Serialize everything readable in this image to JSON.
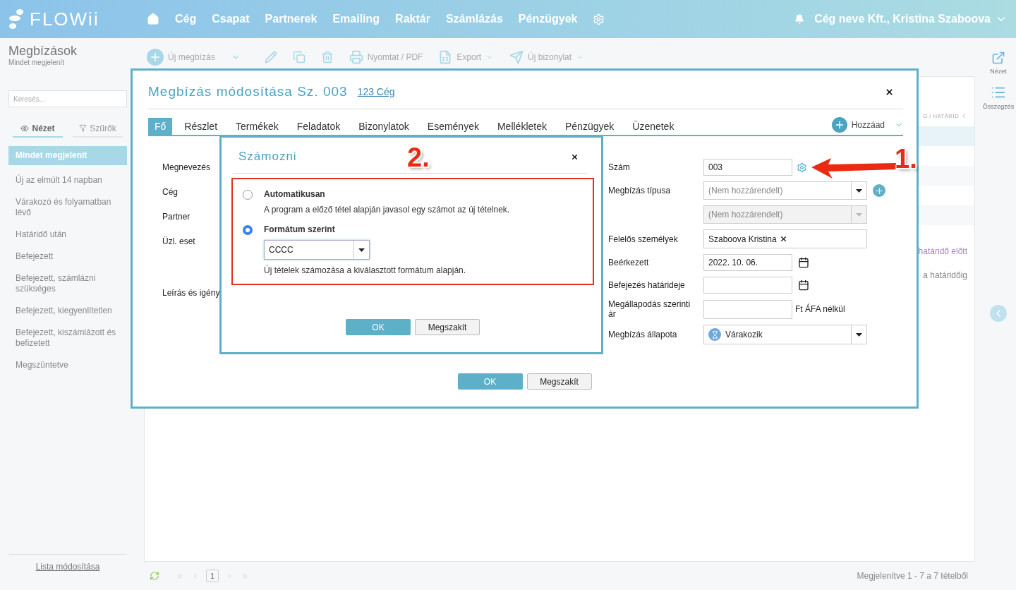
{
  "nav": {
    "logo": "FLOWii",
    "items": [
      "Cég",
      "Csapat",
      "Partnerek",
      "Emailing",
      "Raktár",
      "Számlázás",
      "Pénzügyek"
    ],
    "user": "Cég neve Kft., Kristina Szaboova"
  },
  "sidebar": {
    "title": "Megbízások",
    "subtitle": "Mindet megjelenít",
    "search_placeholder": "Keresés...",
    "tabs": [
      {
        "label": "Nézet",
        "selected": true
      },
      {
        "label": "Szűrők",
        "selected": false
      }
    ],
    "items": [
      {
        "label": "Mindet megjelenít",
        "selected": true
      },
      {
        "label": "Új az elmúlt 14 napban",
        "selected": false
      },
      {
        "label": "Várakozó és folyamatban lévő",
        "selected": false
      },
      {
        "label": "Határidő után",
        "selected": false
      },
      {
        "label": "Befejezett",
        "selected": false
      },
      {
        "label": "Befejezett, számlázni szükséges",
        "selected": false
      },
      {
        "label": "Befejezett, kiegyenlítetlen",
        "selected": false
      },
      {
        "label": "Befejezett, kiszámlázott és befizetett",
        "selected": false
      },
      {
        "label": "Megszüntetve",
        "selected": false
      }
    ],
    "footer_link": "Lista módosítása"
  },
  "toolbar": {
    "new": "Új megbízás",
    "print": "Nyomtat / PDF",
    "export": "Export",
    "new_doc": "Új bizonylat"
  },
  "list": {
    "header_fragment": "G / HATÁRID",
    "cells": [
      "határidő előtt",
      "a határidőig"
    ]
  },
  "pager": {
    "page": "1",
    "summary": "Megjelenítve 1 - 7 a 7 tételből"
  },
  "right_rail": [
    "Nézet",
    "Összegzés"
  ],
  "edit_dialog": {
    "title": "Megbízás módosítása Sz. 003",
    "company_link": "123 Cég",
    "tabs": [
      {
        "label": "Fő",
        "selected": true
      },
      {
        "label": "Részlet",
        "selected": false
      },
      {
        "label": "Termékek",
        "selected": false
      },
      {
        "label": "Feladatok",
        "selected": false
      },
      {
        "label": "Bizonylatok",
        "selected": false
      },
      {
        "label": "Események",
        "selected": false
      },
      {
        "label": "Mellékletek",
        "selected": false
      },
      {
        "label": "Pénzügyek",
        "selected": false
      },
      {
        "label": "Üzenetek",
        "selected": false
      }
    ],
    "add_button": "Hozzáad",
    "left_labels": [
      {
        "label": "Megnevezés",
        "kind": "line"
      },
      {
        "label": "Cég",
        "kind": "line"
      },
      {
        "label": "Partner",
        "kind": "line"
      },
      {
        "label": "Üzl. eset",
        "kind": "tall"
      },
      {
        "label": "Leírás és igény",
        "kind": "line"
      }
    ],
    "fields": [
      {
        "kind": "text",
        "label": "Szám",
        "value": "003"
      },
      {
        "kind": "select",
        "label": "Megbízás típusa",
        "placeholder": "(Nem hozzárendelt)",
        "disabled": false
      },
      {
        "kind": "select",
        "placeholder": "(Nem hozzárendelt)",
        "disabled": true
      },
      {
        "kind": "tags",
        "label": "Felelős személyek",
        "value": "Szaboova Kristina"
      },
      {
        "kind": "date",
        "label": "Beérkezett",
        "value": "2022. 10. 06."
      },
      {
        "kind": "date",
        "label": "Befejezés határideje"
      },
      {
        "kind": "price",
        "label": "Megállapodás szerinti ár",
        "suffix": "Ft ÁFA nélkül"
      },
      {
        "kind": "status",
        "label": "Megbízás állapota",
        "value": "Várakozik"
      }
    ],
    "ok": "OK",
    "cancel": "Megszakít"
  },
  "numbering_dialog": {
    "title": "Számozni",
    "options": [
      {
        "label": "Automatikusan",
        "description": "A program a előző tétel alapján javasol egy számot az új tételnek.",
        "selected": false
      },
      {
        "label": "Formátum szerint",
        "format": "CCCC",
        "description": "Új tételek számozása a kiválasztott formátum alapján.",
        "selected": true
      }
    ],
    "ok": "OK",
    "cancel": "Megszakít"
  },
  "annotations": [
    "2.",
    "1."
  ]
}
